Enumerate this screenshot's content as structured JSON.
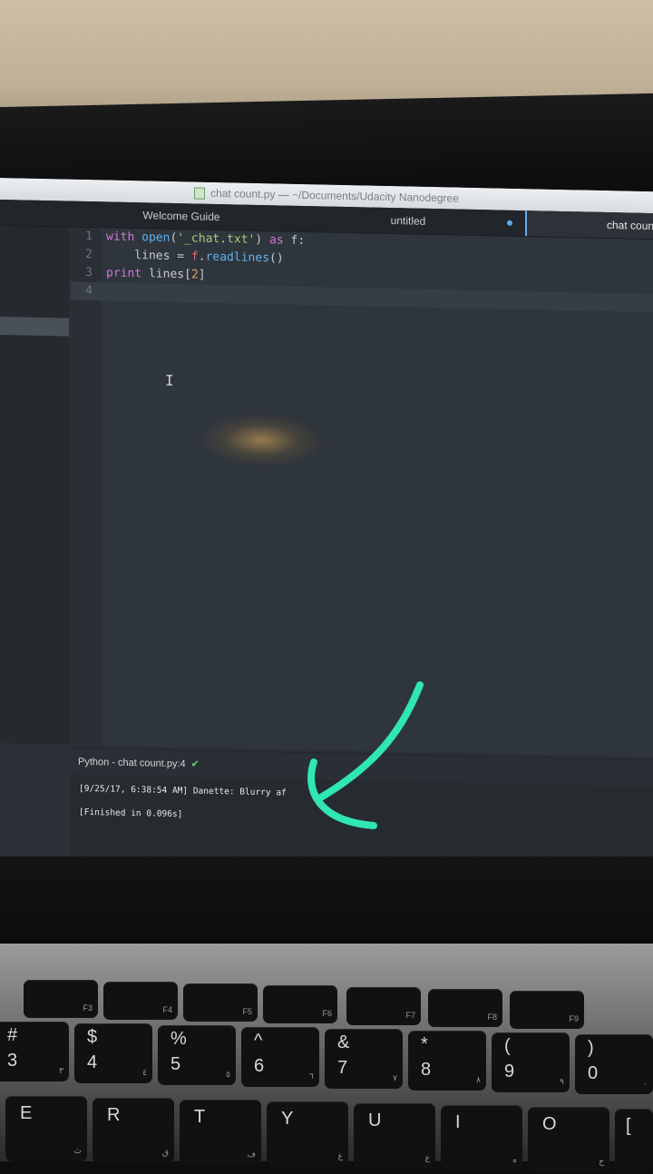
{
  "window": {
    "title": "chat count.py — ~/Documents/Udacity Nanodegree"
  },
  "tabs": [
    {
      "label": "Welcome Guide"
    },
    {
      "label": "untitled",
      "modified": true
    },
    {
      "label": "chat coun"
    }
  ],
  "editor": {
    "lines": [
      {
        "num": "1"
      },
      {
        "num": "2"
      },
      {
        "num": "3"
      },
      {
        "num": "4"
      }
    ],
    "code": {
      "l1": {
        "kw_with": "with",
        "fn_open": "open",
        "p1": "(",
        "str": "'_chat.txt'",
        "p2": ")",
        "kw_as": " as",
        "rest": " f:"
      },
      "l2": {
        "indent": "    lines = ",
        "var": "f",
        "dot": ".",
        "fn": "readlines",
        "rest": "()"
      },
      "l3": {
        "kw": "print",
        "mid": " lines",
        "br1": "[",
        "num": "2",
        "br2": "]"
      }
    },
    "cursor_glyph": "I"
  },
  "status": {
    "label": "Python - chat count.py:4",
    "check": "✔"
  },
  "output": {
    "line1": "[9/25/17, 6:38:54 AM] Danette: Blurry af",
    "line2": "[Finished in 0.096s]"
  },
  "keyboard": {
    "fn_row": [
      "F3",
      "F4",
      "F5",
      "F6",
      "F7",
      "F8",
      "F9"
    ],
    "num_row": [
      {
        "top": "#",
        "main": "3",
        "alt": "٣"
      },
      {
        "top": "$",
        "main": "4",
        "alt": "٤"
      },
      {
        "top": "%",
        "main": "5",
        "alt": "٥"
      },
      {
        "top": "^",
        "main": "6",
        "alt": "٦"
      },
      {
        "top": "&",
        "main": "7",
        "alt": "٧"
      },
      {
        "top": "*",
        "main": "8",
        "alt": "٨"
      },
      {
        "top": "(",
        "main": "9",
        "alt": "٩"
      },
      {
        "top": ")",
        "main": "0",
        "alt": "٠"
      }
    ],
    "letter_row": [
      {
        "main": "E",
        "alt": "ث"
      },
      {
        "main": "R",
        "alt": "ق"
      },
      {
        "main": "T",
        "alt": "ف"
      },
      {
        "main": "Y",
        "alt": "غ"
      },
      {
        "main": "U",
        "alt": "ع"
      },
      {
        "main": "I",
        "alt": "ه"
      },
      {
        "main": "O",
        "alt": "خ"
      },
      {
        "main": "[",
        "alt": ""
      }
    ]
  },
  "colors": {
    "accent": "#5fa8f0",
    "annotation": "#2fe6b4",
    "success": "#6fd36f"
  }
}
